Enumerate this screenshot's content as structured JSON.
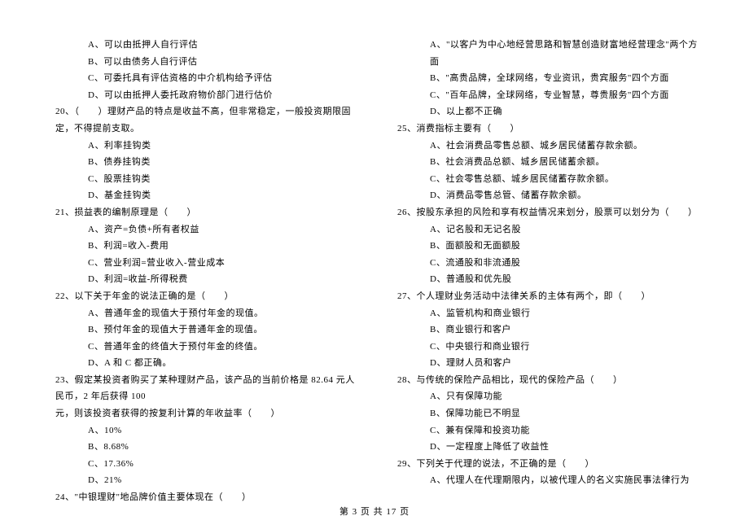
{
  "left_column": [
    {
      "type": "option",
      "text": "A、可以由抵押人自行评估"
    },
    {
      "type": "option",
      "text": "B、可以由债务人自行评估"
    },
    {
      "type": "option",
      "text": "C、可委托具有评估资格的中介机构给予评估"
    },
    {
      "type": "option",
      "text": "D、可以由抵押人委托政府物价部门进行估价"
    },
    {
      "type": "question",
      "text": "20、（　　）理财产品的特点是收益不高，但非常稳定，一般投资期限固定，不得提前支取。"
    },
    {
      "type": "option",
      "text": "A、利率挂钩类"
    },
    {
      "type": "option",
      "text": "B、债券挂钩类"
    },
    {
      "type": "option",
      "text": "C、股票挂钩类"
    },
    {
      "type": "option",
      "text": "D、基金挂钩类"
    },
    {
      "type": "question",
      "text": "21、损益表的编制原理是（　　）"
    },
    {
      "type": "option",
      "text": "A、资产=负债+所有者权益"
    },
    {
      "type": "option",
      "text": "B、利润=收入-费用"
    },
    {
      "type": "option",
      "text": "C、营业利润=营业收入-营业成本"
    },
    {
      "type": "option",
      "text": "D、利润=收益-所得税费"
    },
    {
      "type": "question",
      "text": "22、以下关于年金的说法正确的是（　　）"
    },
    {
      "type": "option",
      "text": "A、普通年金的现值大于预付年金的现值。"
    },
    {
      "type": "option",
      "text": "B、预付年金的现值大于普通年金的现值。"
    },
    {
      "type": "option",
      "text": "C、普通年金的终值大于预付年金的终值。"
    },
    {
      "type": "option",
      "text": "D、A 和 C 都正确。"
    },
    {
      "type": "question",
      "text": "23、假定某投资者购买了某种理财产品，该产品的当前价格是 82.64 元人民币，2 年后获得 100"
    },
    {
      "type": "sub",
      "text": "元，则该投资者获得的按复利计算的年收益率（　　）"
    },
    {
      "type": "option",
      "text": "A、10%"
    },
    {
      "type": "option",
      "text": "B、8.68%"
    },
    {
      "type": "option",
      "text": "C、17.36%"
    },
    {
      "type": "option",
      "text": "D、21%"
    },
    {
      "type": "question",
      "text": "24、\"中银理财\"地品牌价值主要体现在（　　）"
    }
  ],
  "right_column": [
    {
      "type": "option",
      "text": "A、\"以客户为中心地经营思路和智慧创造财富地经营理念\"两个方面"
    },
    {
      "type": "option",
      "text": "B、\"高贵品牌，全球网络，专业资讯，贵宾服务\"四个方面"
    },
    {
      "type": "option",
      "text": "C、\"百年品牌，全球网络，专业智慧，尊贵服务\"四个方面"
    },
    {
      "type": "option",
      "text": "D、以上都不正确"
    },
    {
      "type": "question",
      "text": "25、消费指标主要有（　　）"
    },
    {
      "type": "option",
      "text": "A、社会消费品零售总额、城乡居民储蓄存款余额。"
    },
    {
      "type": "option",
      "text": "B、社会消费品总额、城乡居民储蓄余额。"
    },
    {
      "type": "option",
      "text": "C、社会零售总额、城乡居民储蓄存款余额。"
    },
    {
      "type": "option",
      "text": "D、消费品零售总管、储蓄存款余额。"
    },
    {
      "type": "question",
      "text": "26、按股东承担的风险和享有权益情况来划分，股票可以划分为（　　）"
    },
    {
      "type": "option",
      "text": "A、记名股和无记名股"
    },
    {
      "type": "option",
      "text": "B、面额股和无面额股"
    },
    {
      "type": "option",
      "text": "C、流通股和非流通股"
    },
    {
      "type": "option",
      "text": "D、普通股和优先股"
    },
    {
      "type": "question",
      "text": "27、个人理财业务活动中法律关系的主体有两个，即（　　）"
    },
    {
      "type": "option",
      "text": "A、监管机构和商业银行"
    },
    {
      "type": "option",
      "text": "B、商业银行和客户"
    },
    {
      "type": "option",
      "text": "C、中央银行和商业银行"
    },
    {
      "type": "option",
      "text": "D、理财人员和客户"
    },
    {
      "type": "question",
      "text": "28、与传统的保险产品相比，现代的保险产品（　　）"
    },
    {
      "type": "option",
      "text": "A、只有保障功能"
    },
    {
      "type": "option",
      "text": "B、保障功能已不明显"
    },
    {
      "type": "option",
      "text": "C、兼有保障和投资功能"
    },
    {
      "type": "option",
      "text": "D、一定程度上降低了收益性"
    },
    {
      "type": "question",
      "text": "29、下列关于代理的说法，不正确的是（　　）"
    },
    {
      "type": "option",
      "text": "A、代理人在代理期限内，以被代理人的名义实施民事法律行为"
    }
  ],
  "footer": "第 3 页 共 17 页"
}
